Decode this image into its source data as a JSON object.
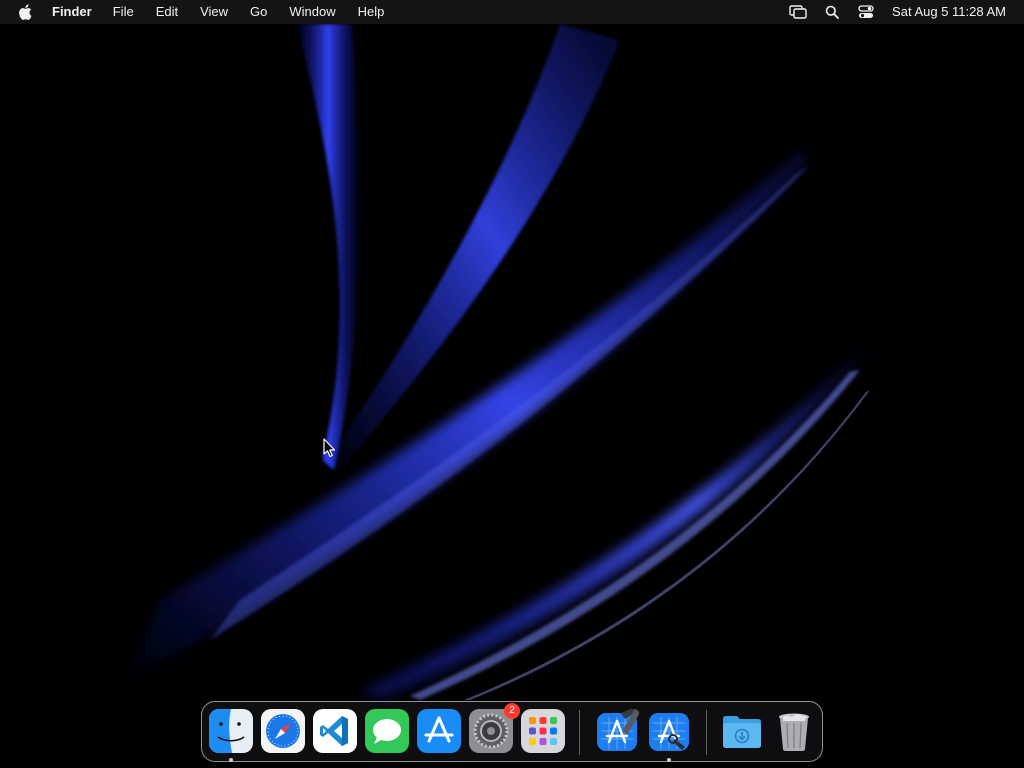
{
  "menubar": {
    "apple_icon": "apple-logo-icon",
    "app_name": "Finder",
    "menus": [
      "File",
      "Edit",
      "View",
      "Go",
      "Window",
      "Help"
    ],
    "status_icons": [
      "screen-mirroring-icon",
      "spotlight-search-icon",
      "control-center-icon"
    ],
    "clock": "Sat Aug 5  11:28 AM"
  },
  "dock": {
    "apps": [
      {
        "icon": "finder-icon",
        "running": true
      },
      {
        "icon": "safari-icon",
        "running": false
      },
      {
        "icon": "vscode-icon",
        "running": false
      },
      {
        "icon": "messages-icon",
        "running": false
      },
      {
        "icon": "app-store-icon",
        "running": false
      },
      {
        "icon": "system-settings-icon",
        "running": false,
        "badge": "2"
      },
      {
        "icon": "launchpad-icon",
        "running": false
      },
      {
        "icon": "xcode-icon",
        "running": false
      },
      {
        "icon": "xcode-instruments-icon",
        "running": true
      },
      {
        "icon": "downloads-folder-icon",
        "running": false
      },
      {
        "icon": "trash-icon",
        "running": false
      }
    ]
  },
  "colors": {
    "wallpaper_background": "#000000",
    "wallpaper_streak": "#2b3bff",
    "menubar": "#161618",
    "badge": "#ff3b30"
  }
}
